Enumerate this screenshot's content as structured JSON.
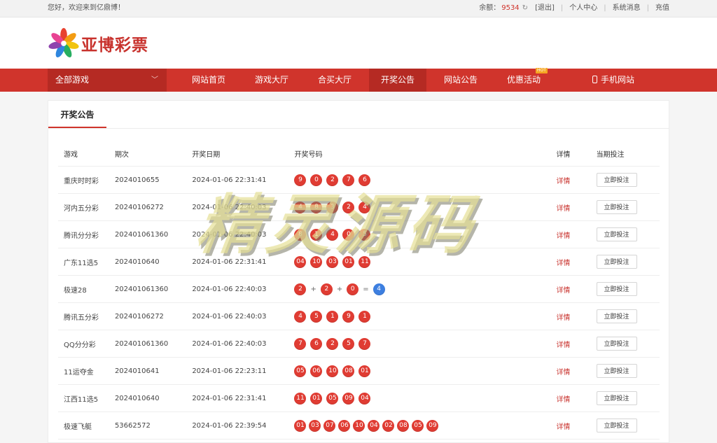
{
  "topbar": {
    "greeting": "您好，欢迎来到亿鼎博！",
    "balance_label": "余额：",
    "balance_value": "9534",
    "logout": "[退出]",
    "personal": "个人中心",
    "messages": "系统消息",
    "recharge": "充值"
  },
  "header": {
    "logo_text": "亚博彩票"
  },
  "nav": {
    "all_games": "全部游戏",
    "items": [
      "网站首页",
      "游戏大厅",
      "合买大厅",
      "开奖公告",
      "网站公告",
      "优惠活动",
      "手机网站"
    ],
    "hot_badge": "HOT",
    "active_index": 3
  },
  "panel": {
    "tab": "开奖公告",
    "columns": [
      "游戏",
      "期次",
      "开奖日期",
      "开奖号码",
      "详情",
      "当期投注"
    ],
    "detail_label": "详情",
    "bet_label": "立即投注",
    "rows": [
      {
        "game": "重庆时时彩",
        "issue": "2024010655",
        "date": "2024-01-06 22:31:41",
        "nums": [
          "9",
          "0",
          "2",
          "7",
          "6"
        ]
      },
      {
        "game": "河内五分彩",
        "issue": "20240106272",
        "date": "2024-01-06 22:40:03",
        "nums": [
          "4",
          "8",
          "3",
          "2",
          "4"
        ]
      },
      {
        "game": "腾讯分分彩",
        "issue": "202401061360",
        "date": "2024-01-06 22:40:03",
        "nums": [
          "8",
          "1",
          "4",
          "0",
          "5"
        ]
      },
      {
        "game": "广东11选5",
        "issue": "2024010640",
        "date": "2024-01-06 22:31:41",
        "nums": [
          "04",
          "10",
          "03",
          "01",
          "11"
        ]
      },
      {
        "game": "极速28",
        "issue": "202401061360",
        "date": "2024-01-06 22:40:03",
        "nums": [
          "2",
          "2",
          "0"
        ],
        "sum": "4"
      },
      {
        "game": "腾讯五分彩",
        "issue": "20240106272",
        "date": "2024-01-06 22:40:03",
        "nums": [
          "4",
          "5",
          "1",
          "9",
          "1"
        ]
      },
      {
        "game": "QQ分分彩",
        "issue": "202401061360",
        "date": "2024-01-06 22:40:03",
        "nums": [
          "7",
          "6",
          "2",
          "5",
          "7"
        ]
      },
      {
        "game": "11运夺金",
        "issue": "2024010641",
        "date": "2024-01-06 22:23:11",
        "nums": [
          "05",
          "06",
          "10",
          "08",
          "01"
        ]
      },
      {
        "game": "江西11选5",
        "issue": "2024010640",
        "date": "2024-01-06 22:31:41",
        "nums": [
          "11",
          "01",
          "05",
          "09",
          "04"
        ]
      },
      {
        "game": "极速飞艇",
        "issue": "53662572",
        "date": "2024-01-06 22:39:54",
        "nums": [
          "01",
          "03",
          "07",
          "06",
          "10",
          "04",
          "02",
          "08",
          "05",
          "09"
        ]
      }
    ]
  },
  "watermark": "精灵源码",
  "colors": {
    "primary": "#d0342c",
    "ball_red": "#e03c33",
    "ball_blue": "#3d7fe0"
  }
}
